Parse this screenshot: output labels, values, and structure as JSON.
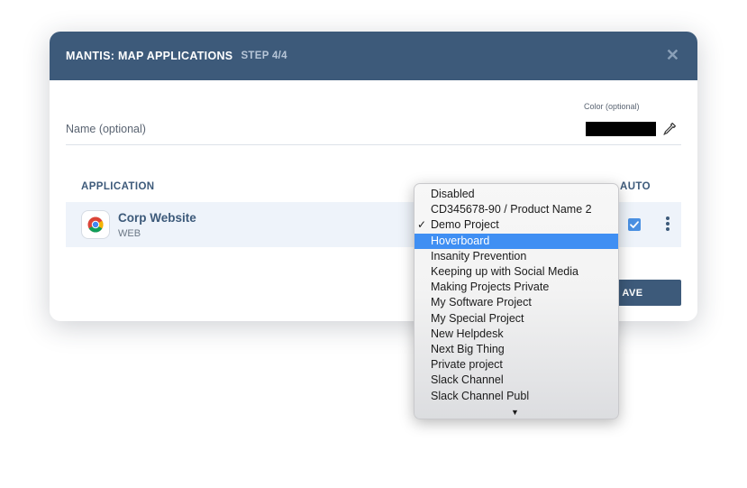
{
  "modal": {
    "title": "MANTIS: MAP APPLICATIONS",
    "step": "STEP 4/4",
    "close_icon": "close-icon"
  },
  "form": {
    "name_label": "Name (optional)",
    "color_label": "Color (optional)",
    "color_value": "#000000",
    "eyedropper_icon": "eyedropper-icon"
  },
  "table": {
    "headers": {
      "application": "APPLICATION",
      "auto": "AUTO"
    },
    "rows": [
      {
        "app_name": "Corp Website",
        "app_type": "WEB",
        "icon": "chrome-icon",
        "auto_checked": true
      }
    ]
  },
  "actions": {
    "save_label": "AVE"
  },
  "dropdown": {
    "options": [
      "Disabled",
      "CD345678-90 / Product Name 2",
      "Demo Project",
      "Hoverboard",
      "Insanity Prevention",
      "Keeping up with Social Media",
      "Making Projects Private",
      "My Software Project",
      "My Special Project",
      "New Helpdesk",
      "Next Big Thing",
      "Private project",
      "Slack Channel",
      "Slack Channel Publ"
    ],
    "checked_index": 2,
    "highlighted_index": 3,
    "check_mark": "✓",
    "scroll_arrow": "▼"
  },
  "colors": {
    "header": "#3d5a7a",
    "accent": "#3f8ff3",
    "checkbox": "#4a90e2"
  }
}
